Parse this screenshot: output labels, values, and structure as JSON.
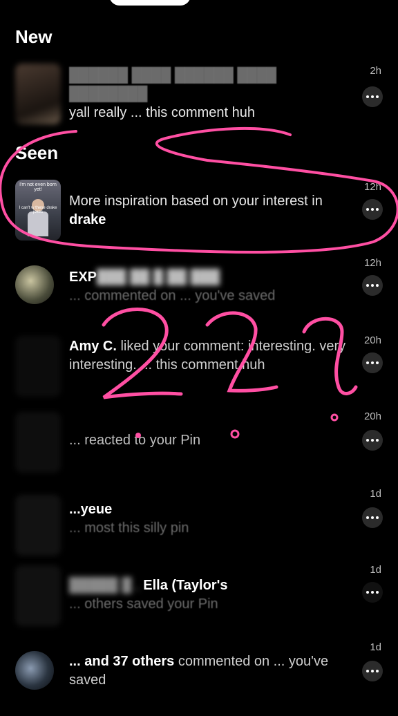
{
  "sections": {
    "new_title": "New",
    "seen_title": "Seen"
  },
  "rows": [
    {
      "prefix": "",
      "highlight": "",
      "suffix": "yall really ... this comment huh",
      "time": "2h"
    },
    {
      "prefix": "More inspiration based on your interest in ",
      "highlight": "drake",
      "suffix": "",
      "time": "12h",
      "thumb_caption_top": "I'm not even born yet!",
      "thumb_caption_mid": "I can't w these drake jokes"
    },
    {
      "prefix": "",
      "highlight": "EXP",
      "suffix": " ... commented on ... you've saved",
      "time": "12h"
    },
    {
      "prefix": "",
      "highlight": "Amy C.",
      "suffix": " liked your comment: interesting. very interesting. ... this comment huh",
      "time": "20h"
    },
    {
      "prefix": "",
      "highlight": "",
      "suffix": "... reacted to your Pin",
      "time": "20h"
    },
    {
      "prefix": "",
      "highlight": "...yeue",
      "suffix": " ... most this silly pin",
      "time": "1d"
    },
    {
      "prefix": "",
      "highlight": "Ella (Taylor's",
      "suffix": " ... others saved your Pin",
      "time": "1d"
    },
    {
      "prefix": "",
      "highlight": "... and 37 others",
      "suffix": " commented on ... you've saved",
      "time": "1d"
    }
  ],
  "overlay": {
    "scribble_text": "???",
    "scribble_color": "#ff4fa3"
  },
  "icons": {
    "more": "more-horizontal-icon"
  }
}
